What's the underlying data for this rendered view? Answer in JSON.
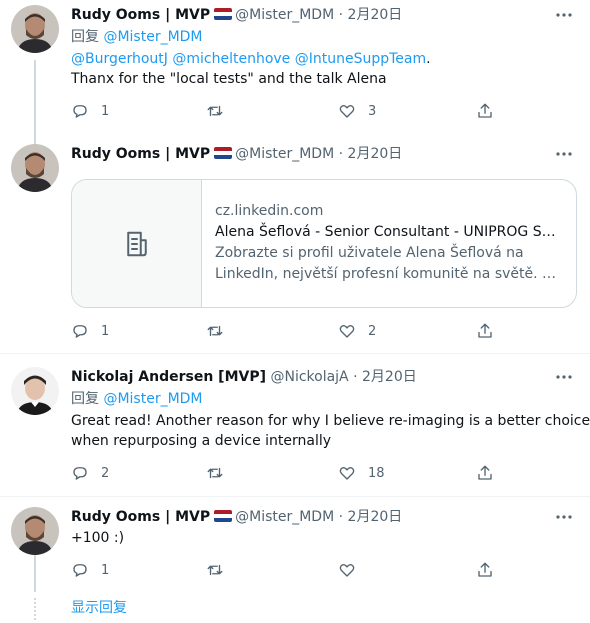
{
  "tweets": [
    {
      "name": "Rudy Ooms | MVP",
      "handle": "@Mister_MDM",
      "separator": "·",
      "date": "2月20日",
      "reply_prefix": "回复",
      "reply_to": "@Mister_MDM",
      "mentions": "@BurgerhoutJ @micheltenhove @IntuneSuppTeam",
      "mentions_suffix": ".",
      "text": "Thanx for the \"local tests\" and the talk Alena",
      "reply_count": "1",
      "retweet_count": "",
      "like_count": "3"
    },
    {
      "name": "Rudy Ooms | MVP",
      "handle": "@Mister_MDM",
      "separator": "·",
      "date": "2月20日",
      "card": {
        "domain": "cz.linkedin.com",
        "title": "Alena Šeflová - Senior Consultant - UNIPROG SOL...",
        "desc_line1": "Zobrazte si profil uživatele Alena Šeflová na",
        "desc_line2": "LinkedIn, největší profesní komunitě na světě. Ale..."
      },
      "reply_count": "1",
      "retweet_count": "",
      "like_count": "2"
    },
    {
      "name": "Nickolaj Andersen [MVP]",
      "handle": "@NickolajA",
      "separator": "·",
      "date": "2月20日",
      "reply_prefix": "回复",
      "reply_to": "@Mister_MDM",
      "text_line1": "Great read! Another reason for why I believe re-imaging is a better choice",
      "text_line2": "when repurposing a device internally",
      "reply_count": "2",
      "retweet_count": "",
      "like_count": "18"
    },
    {
      "name": "Rudy Ooms | MVP",
      "handle": "@Mister_MDM",
      "separator": "·",
      "date": "2月20日",
      "text": "+100 :)",
      "reply_count": "1",
      "retweet_count": "",
      "like_count": ""
    }
  ],
  "show_replies_label": "显示回复",
  "icons": {
    "more": "more-icon",
    "reply": "reply-icon",
    "retweet": "retweet-icon",
    "like": "like-icon",
    "share": "share-icon",
    "flag": "netherlands-flag-icon",
    "card": "document-icon"
  },
  "colors": {
    "link": "#1d9bf0",
    "muted": "#536471",
    "text": "#0f1419",
    "border": "#cfd9de"
  }
}
